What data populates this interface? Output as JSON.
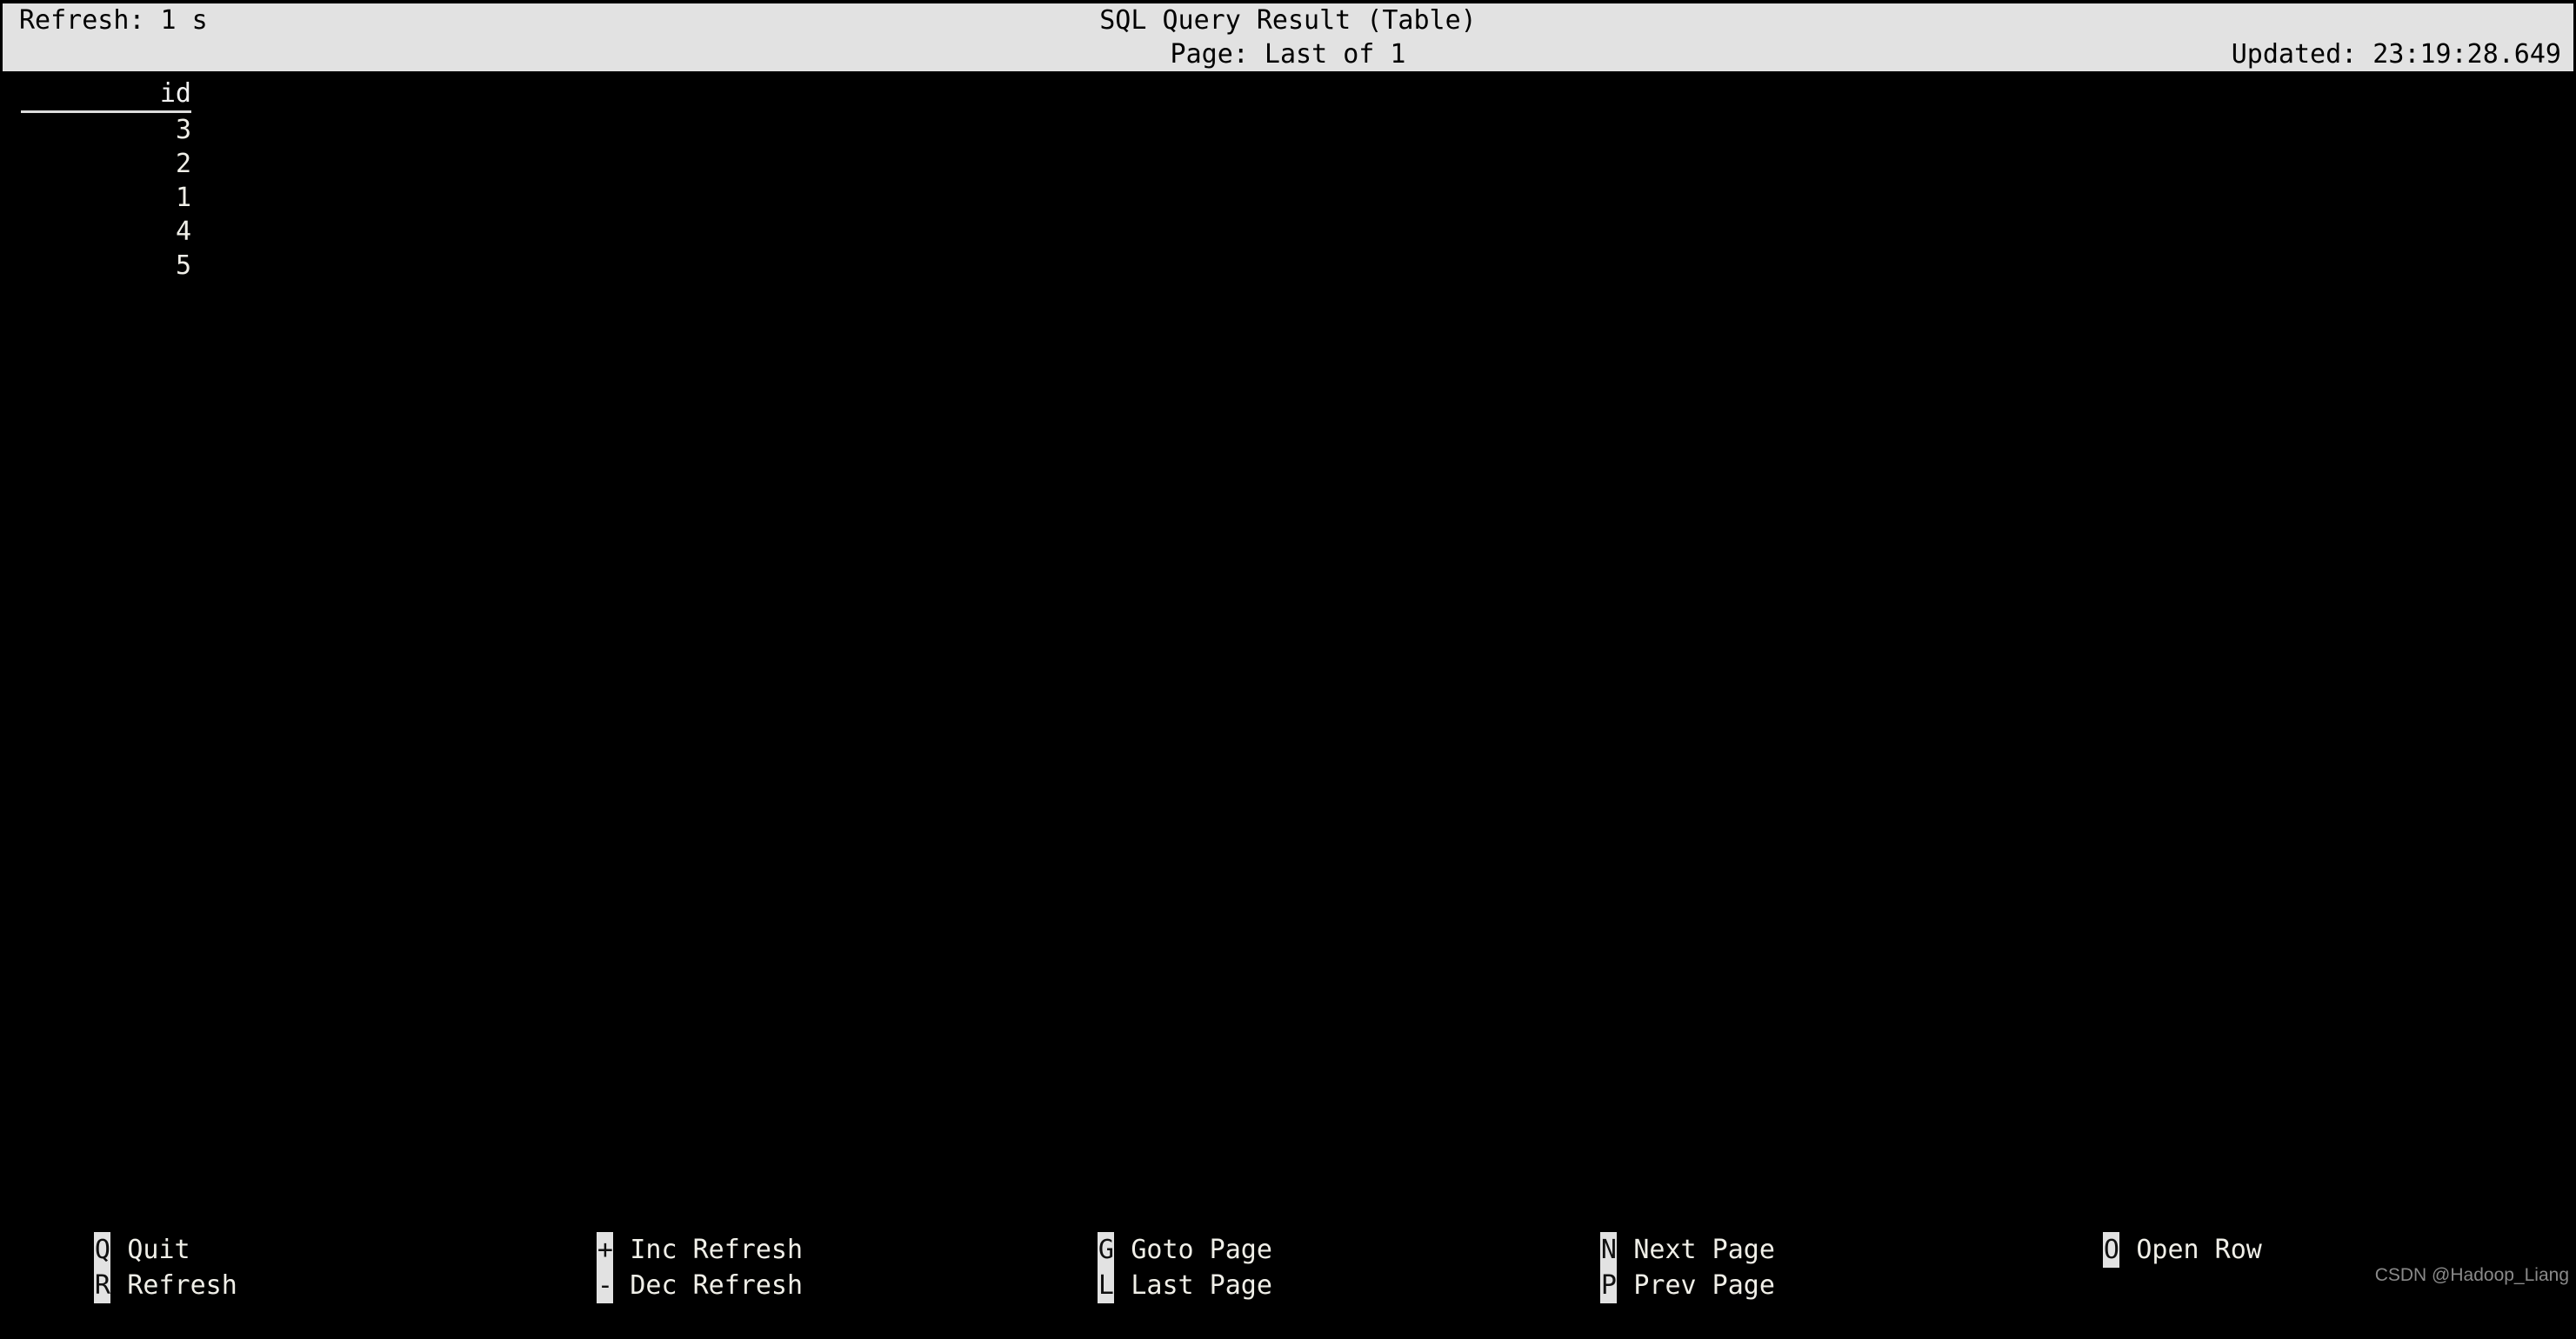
{
  "header": {
    "refresh_label": "Refresh: 1 s",
    "title": "SQL Query Result (Table)",
    "page_status": "Page: Last of 1",
    "updated": "Updated: 23:19:28.649",
    "bar_bg": "#e2e2e2",
    "bar_fg": "#000000"
  },
  "table": {
    "columns": [
      {
        "name": "id"
      }
    ],
    "rows": [
      {
        "id": "3"
      },
      {
        "id": "2"
      },
      {
        "id": "1"
      },
      {
        "id": "4"
      },
      {
        "id": "5"
      }
    ]
  },
  "footer": {
    "columns": [
      {
        "bindings": [
          {
            "key": "Q",
            "label": "Quit"
          },
          {
            "key": "R",
            "label": "Refresh"
          }
        ]
      },
      {
        "bindings": [
          {
            "key": "+",
            "label": "Inc Refresh"
          },
          {
            "key": "-",
            "label": "Dec Refresh"
          }
        ]
      },
      {
        "bindings": [
          {
            "key": "G",
            "label": "Goto Page"
          },
          {
            "key": "L",
            "label": "Last Page"
          }
        ]
      },
      {
        "bindings": [
          {
            "key": "N",
            "label": "Next Page"
          },
          {
            "key": "P",
            "label": "Prev Page"
          }
        ]
      },
      {
        "bindings": [
          {
            "key": "O",
            "label": "Open Row"
          }
        ]
      }
    ]
  },
  "watermark": "CSDN @Hadoop_Liang",
  "colors": {
    "background": "#000000",
    "foreground": "#f0efe8",
    "highlight_bg": "#e2e2e2",
    "highlight_fg": "#101010",
    "rule": "#dcdcdc"
  }
}
